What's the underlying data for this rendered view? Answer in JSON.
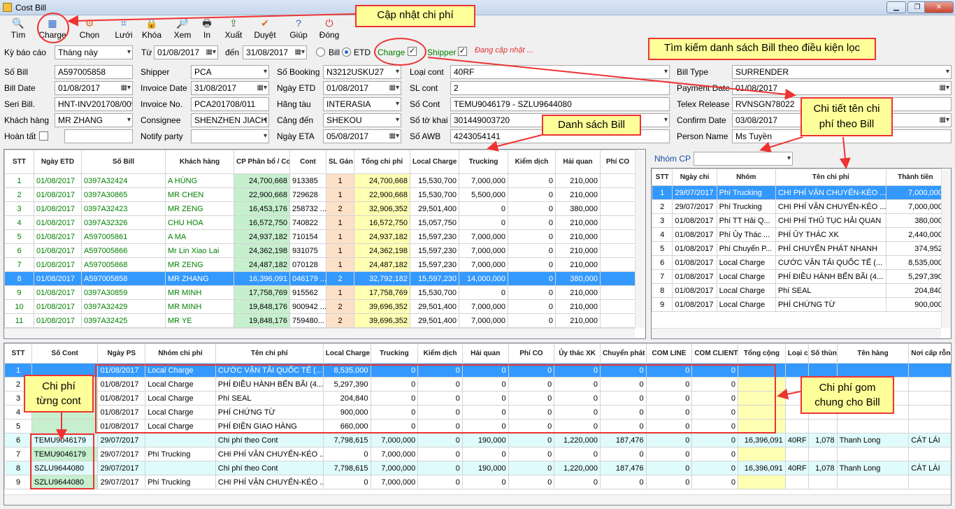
{
  "window": {
    "title": "Cost Bill"
  },
  "toolbar": [
    {
      "label": "Tìm",
      "icon": "search-icon",
      "glyph": "🔍"
    },
    {
      "label": "Charge",
      "icon": "calculator-icon",
      "glyph": "▦"
    },
    {
      "label": "Chọn",
      "icon": "gear-icon",
      "glyph": "⚙"
    },
    {
      "label": "Lưới",
      "icon": "grid-icon",
      "glyph": "⌗"
    },
    {
      "label": "Khóa",
      "icon": "lock-icon",
      "glyph": "🔒"
    },
    {
      "label": "Xem",
      "icon": "preview-icon",
      "glyph": "🔎"
    },
    {
      "label": "In",
      "icon": "printer-icon",
      "glyph": "🖶"
    },
    {
      "label": "Xuất",
      "icon": "export-icon",
      "glyph": "⇪"
    },
    {
      "label": "Duyệt",
      "icon": "approve-icon",
      "glyph": "✔"
    },
    {
      "label": "Giúp",
      "icon": "help-icon",
      "glyph": "?"
    },
    {
      "label": "Đóng",
      "icon": "power-icon",
      "glyph": "⏻"
    }
  ],
  "filter": {
    "ky_label": "Kỳ báo cáo",
    "ky_value": "Tháng này",
    "tu_label": "Từ",
    "tu_value": "01/08/2017",
    "den_label": "đến",
    "den_value": "31/08/2017",
    "bill_label": "Bill",
    "etd_label": "ETD",
    "charge_label": "Charge",
    "shipper_label": "Shipper",
    "status": "Đang cập nhật ..."
  },
  "form": {
    "so_bill": {
      "label": "Số Bill",
      "value": "A597005858"
    },
    "bill_date": {
      "label": "Bill Date",
      "value": "01/08/2017"
    },
    "seri_bill": {
      "label": "Seri Bill.",
      "value": "HNT-INV201708/009"
    },
    "khach_hang": {
      "label": "Khách hàng",
      "value": "MR ZHANG"
    },
    "hoan_tat": {
      "label": "Hoàn tất",
      "value": ""
    },
    "shipper": {
      "label": "Shipper",
      "value": "PCA"
    },
    "invoice_date": {
      "label": "Invoice Date",
      "value": "31/08/2017"
    },
    "invoice_no": {
      "label": "Invoice No.",
      "value": "PCA201708/011"
    },
    "consignee": {
      "label": "Consignee",
      "value": "SHENZHEN JIACH"
    },
    "notify": {
      "label": "Notify party",
      "value": ""
    },
    "so_booking": {
      "label": "Số Booking",
      "value": "N3212USKU27"
    },
    "ngay_etd": {
      "label": "Ngày ETD",
      "value": "01/08/2017"
    },
    "hang_tau": {
      "label": "Hãng tàu",
      "value": "INTERASIA"
    },
    "cang_den": {
      "label": "Cảng đến",
      "value": "SHEKOU"
    },
    "ngay_eta": {
      "label": "Ngày ETA",
      "value": "05/08/2017"
    },
    "loai_cont": {
      "label": "Loại cont",
      "value": "40RF"
    },
    "sl_cont": {
      "label": "SL cont",
      "value": "2"
    },
    "so_cont": {
      "label": "Số Cont",
      "value": "TEMU9046179 - SZLU9644080"
    },
    "so_to_khai": {
      "label": "Số tờ khai",
      "value": "301449003720"
    },
    "so_awb": {
      "label": "Số AWB",
      "value": "4243054141"
    },
    "bill_type": {
      "label": "Bill Type",
      "value": "SURRENDER"
    },
    "payment_date": {
      "label": "Payment Date",
      "value": "01/08/2017"
    },
    "telex": {
      "label": "Telex Release",
      "value": "RVNSGN78022"
    },
    "confirm": {
      "label": "Confirm Date",
      "value": "03/08/2017"
    },
    "person": {
      "label": "Person Name",
      "value": "Ms Tuyền"
    }
  },
  "bills": {
    "headers": [
      "STT",
      "Ngày ETD",
      "Số Bill",
      "Khách hàng",
      "CP Phân bổ / Cont",
      "Cont",
      "SL Gán",
      "Tổng chi phí",
      "Local Charge",
      "Trucking",
      "Kiểm dịch",
      "Hải quan",
      "Phí CO"
    ],
    "rows": [
      [
        "1",
        "01/08/2017",
        "0397A32424",
        "A HÙNG",
        "24,700,668",
        "913385",
        "1",
        "24,700,668",
        "15,530,700",
        "7,000,000",
        "0",
        "210,000",
        ""
      ],
      [
        "2",
        "01/08/2017",
        "0397A30865",
        "MR CHEN",
        "22,900,668",
        "729628",
        "1",
        "22,900,668",
        "15,530,700",
        "5,500,000",
        "0",
        "210,000",
        ""
      ],
      [
        "3",
        "01/08/2017",
        "0397A32423",
        "MR ZENG",
        "16,453,176",
        "258732 ...",
        "2",
        "32,906,352",
        "29,501,400",
        "0",
        "0",
        "380,000",
        ""
      ],
      [
        "4",
        "01/08/2017",
        "0397A32326",
        "CHU HOA",
        "16,572,750",
        "740822",
        "1",
        "16,572,750",
        "15,057,750",
        "0",
        "0",
        "210,000",
        ""
      ],
      [
        "5",
        "01/08/2017",
        "A597005861",
        "A MA",
        "24,937,182",
        "710154",
        "1",
        "24,937,182",
        "15,597,230",
        "7,000,000",
        "0",
        "210,000",
        ""
      ],
      [
        "6",
        "01/08/2017",
        "A597005866",
        "Mr Lin Xiao Lai",
        "24,362,198",
        "931075",
        "1",
        "24,362,198",
        "15,597,230",
        "7,000,000",
        "0",
        "210,000",
        ""
      ],
      [
        "7",
        "01/08/2017",
        "A597005868",
        "MR ZENG",
        "24,487,182",
        "070128",
        "1",
        "24,487,182",
        "15,597,230",
        "7,000,000",
        "0",
        "210,000",
        ""
      ],
      [
        "8",
        "01/08/2017",
        "A597005858",
        "MR ZHANG",
        "16,396,091",
        "046179 ...",
        "2",
        "32,792,182",
        "15,597,230",
        "14,000,000",
        "0",
        "380,000",
        ""
      ],
      [
        "9",
        "01/08/2017",
        "0397A30859",
        "MR MINH",
        "17,758,769",
        "915562",
        "1",
        "17,758,769",
        "15,530,700",
        "0",
        "0",
        "210,000",
        ""
      ],
      [
        "10",
        "01/08/2017",
        "0397A32429",
        "MR MINH",
        "19,848,176",
        "900942 ...",
        "2",
        "39,696,352",
        "29,501,400",
        "7,000,000",
        "0",
        "210,000",
        ""
      ],
      [
        "11",
        "01/08/2017",
        "0397A32425",
        "MR YE",
        "19,848,176",
        "759480...",
        "2",
        "39,696,352",
        "29,501,400",
        "7,000,000",
        "0",
        "210,000",
        ""
      ]
    ],
    "selected": 7
  },
  "nhom": {
    "label": "Nhóm CP",
    "value": ""
  },
  "details": {
    "headers": [
      "STT",
      "Ngày chi",
      "Nhóm",
      "Tên chi phí",
      "Thành tiền"
    ],
    "rows": [
      [
        "1",
        "29/07/2017",
        "Phí Trucking",
        "CHI PHÍ VẬN CHUYỂN-KÉO ...",
        "7,000,000"
      ],
      [
        "2",
        "29/07/2017",
        "Phí Trucking",
        "CHI PHÍ VẬN CHUYỂN-KÉO ...",
        "7,000,000"
      ],
      [
        "3",
        "01/08/2017",
        "Phí TT Hải Q...",
        "CHI PHÍ THỦ TỤC HẢI QUAN",
        "380,000"
      ],
      [
        "4",
        "01/08/2017",
        "Phí Ủy Thác ...",
        "PHÍ ỦY THÁC XK",
        "2,440,000"
      ],
      [
        "5",
        "01/08/2017",
        "Phí Chuyển P...",
        "PHÍ CHUYỂN PHÁT NHANH",
        "374,952"
      ],
      [
        "6",
        "01/08/2017",
        "Local Charge",
        "CƯỚC VẬN TẢI QUỐC TẾ (...",
        "8,535,000"
      ],
      [
        "7",
        "01/08/2017",
        "Local Charge",
        "PHÍ ĐIỀU HÀNH BẾN BÃI (4...",
        "5,297,390"
      ],
      [
        "8",
        "01/08/2017",
        "Local Charge",
        "Phí SEAL",
        "204,840"
      ],
      [
        "9",
        "01/08/2017",
        "Local Charge",
        "PHÍ CHỨNG TỪ",
        "900,000"
      ]
    ],
    "selected": 0
  },
  "conts": {
    "headers": [
      "STT",
      "Số Cont",
      "Ngày PS",
      "Nhóm chi phí",
      "Tên chi phí",
      "Local Charge",
      "Trucking",
      "Kiểm dịch",
      "Hải quan",
      "Phí CO",
      "Ủy thác XK",
      "Chuyển phát",
      "COM LINE",
      "COM CLIENT",
      "Tổng cộng",
      "Loại cont",
      "Số thùng",
      "Tên hàng",
      "Nơi cấp rỗng"
    ],
    "rows": [
      [
        "1",
        "",
        "01/08/2017",
        "Local Charge",
        "CƯỚC VẬN TẢI QUỐC TẾ (...",
        "8,535,000",
        "0",
        "0",
        "0",
        "0",
        "0",
        "0",
        "0",
        "0",
        "",
        "",
        "",
        "",
        ""
      ],
      [
        "2",
        "",
        "01/08/2017",
        "Local Charge",
        "PHÍ ĐIỀU HÀNH BẾN BÃI (4...",
        "5,297,390",
        "0",
        "0",
        "0",
        "0",
        "0",
        "0",
        "0",
        "0",
        "",
        "",
        "",
        "",
        ""
      ],
      [
        "3",
        "",
        "01/08/2017",
        "Local Charge",
        "Phí SEAL",
        "204,840",
        "0",
        "0",
        "0",
        "0",
        "0",
        "0",
        "0",
        "0",
        "",
        "",
        "",
        "",
        ""
      ],
      [
        "4",
        "",
        "01/08/2017",
        "Local Charge",
        "PHÍ CHỨNG TỪ",
        "900,000",
        "0",
        "0",
        "0",
        "0",
        "0",
        "0",
        "0",
        "0",
        "",
        "",
        "",
        "",
        ""
      ],
      [
        "5",
        "",
        "01/08/2017",
        "Local Charge",
        "PHÍ ĐIỆN GIAO HÀNG",
        "660,000",
        "0",
        "0",
        "0",
        "0",
        "0",
        "0",
        "0",
        "0",
        "",
        "",
        "",
        "",
        ""
      ],
      [
        "6",
        "TEMU9046179",
        "29/07/2017",
        "",
        "Chi phí theo Cont",
        "7,798,615",
        "7,000,000",
        "0",
        "190,000",
        "0",
        "1,220,000",
        "187,476",
        "0",
        "0",
        "16,396,091",
        "40RF",
        "1,078",
        "Thanh Long",
        "CÁT LÁI"
      ],
      [
        "7",
        "TEMU9046179",
        "29/07/2017",
        "Phí Trucking",
        "CHI PHÍ VẬN CHUYỂN-KÉO ...",
        "0",
        "7,000,000",
        "0",
        "0",
        "0",
        "0",
        "0",
        "0",
        "0",
        "",
        "",
        "",
        "",
        ""
      ],
      [
        "8",
        "SZLU9644080",
        "29/07/2017",
        "",
        "Chi phí theo Cont",
        "7,798,615",
        "7,000,000",
        "0",
        "190,000",
        "0",
        "1,220,000",
        "187,476",
        "0",
        "0",
        "16,396,091",
        "40RF",
        "1,078",
        "Thanh Long",
        "CÁT LÁI"
      ],
      [
        "9",
        "SZLU9644080",
        "29/07/2017",
        "Phí Trucking",
        "CHI PHÍ VẬN CHUYỂN-KÉO ...",
        "0",
        "7,000,000",
        "0",
        "0",
        "0",
        "0",
        "0",
        "0",
        "0",
        "",
        "",
        "",
        "",
        ""
      ]
    ],
    "selected": 0
  },
  "annotations": {
    "update": "Cập nhật chi phí",
    "search": "Tìm kiếm danh sách Bill theo điều kiện lọc",
    "list": "Danh sách Bill",
    "detail": "Chi tiết tên chi phí theo Bill",
    "percont": "Chi phí từng cont",
    "common": "Chi phí gom chung cho Bill"
  },
  "colors": {
    "accent": "#3399ff",
    "annotation_border": "#e33333",
    "annotation_fill": "#ffff99"
  }
}
